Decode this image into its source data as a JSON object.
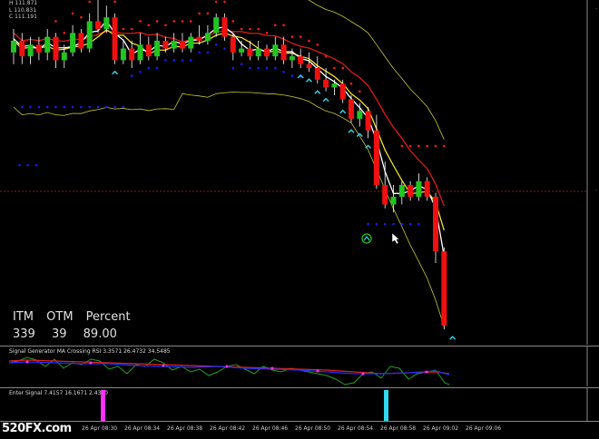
{
  "ohlc": {
    "high": "H 111.871",
    "low": "L 110.831",
    "close": "C 111.191"
  },
  "stats": {
    "headers": [
      "ITM",
      "OTM",
      "Percent"
    ],
    "values": [
      "339",
      "39",
      "89.00"
    ]
  },
  "indicator1": {
    "label": "Signal Generator MA Crossing RSI 3.3571 26.4732 34.5485"
  },
  "indicator2": {
    "label": "Enter Signal 7.4157 16.1671 2.4390"
  },
  "time_axis": [
    "26 Apr 08:30",
    "26 Apr 08:34",
    "26 Apr 08:38",
    "26 Apr 08:42",
    "26 Apr 08:46",
    "26 Apr 08:50",
    "26 Apr 08:54",
    "26 Apr 08:58",
    "26 Apr 09:02",
    "26 Apr 09:06"
  ],
  "watermark": "520FX.com",
  "colors": {
    "bull": "#21c521",
    "bear": "#f01010",
    "signal_up": "#30d8f0",
    "signal_magenta": "#ff30ff",
    "dots_red": "#ff1a1a",
    "dots_blue": "#1a1aff"
  },
  "chart_data": {
    "type": "candlestick",
    "candles": [
      {
        "o": 4,
        "c": 7,
        "h": 10,
        "l": 1
      },
      {
        "o": 7,
        "c": 3,
        "h": 9,
        "l": 1
      },
      {
        "o": 3,
        "c": 6,
        "h": 8,
        "l": 1
      },
      {
        "o": 6,
        "c": 4,
        "h": 8,
        "l": 2
      },
      {
        "o": 4,
        "c": 8,
        "h": 10,
        "l": 2
      },
      {
        "o": 8,
        "c": 2,
        "h": 9,
        "l": 0
      },
      {
        "o": 2,
        "c": 4,
        "h": 6,
        "l": 0
      },
      {
        "o": 4,
        "c": 9,
        "h": 11,
        "l": 3
      },
      {
        "o": 9,
        "c": 5,
        "h": 10,
        "l": 4
      },
      {
        "o": 5,
        "c": 12,
        "h": 14,
        "l": 4
      },
      {
        "o": 12,
        "c": 10,
        "h": 19,
        "l": 9
      },
      {
        "o": 10,
        "c": 13,
        "h": 16,
        "l": 9
      },
      {
        "o": 13,
        "c": 2,
        "h": 14,
        "l": 1
      },
      {
        "o": 2,
        "c": 5,
        "h": 7,
        "l": 1
      },
      {
        "o": 5,
        "c": 2,
        "h": 7,
        "l": 0
      },
      {
        "o": 2,
        "c": 6,
        "h": 9,
        "l": 1
      },
      {
        "o": 6,
        "c": 3,
        "h": 8,
        "l": 2
      },
      {
        "o": 3,
        "c": 7,
        "h": 9,
        "l": 2
      },
      {
        "o": 7,
        "c": 5,
        "h": 8,
        "l": 4
      },
      {
        "o": 5,
        "c": 7,
        "h": 9,
        "l": 4
      },
      {
        "o": 7,
        "c": 5,
        "h": 9,
        "l": 4
      },
      {
        "o": 5,
        "c": 8,
        "h": 9,
        "l": 4
      },
      {
        "o": 8,
        "c": 7,
        "h": 11,
        "l": 6
      },
      {
        "o": 7,
        "c": 9,
        "h": 11,
        "l": 6
      },
      {
        "o": 9,
        "c": 13,
        "h": 14,
        "l": 8
      },
      {
        "o": 13,
        "c": 8,
        "h": 14,
        "l": 7
      },
      {
        "o": 8,
        "c": 4,
        "h": 9,
        "l": 2
      },
      {
        "o": 4,
        "c": 5,
        "h": 7,
        "l": 3
      },
      {
        "o": 5,
        "c": 3,
        "h": 7,
        "l": 2
      },
      {
        "o": 3,
        "c": 5,
        "h": 7,
        "l": 2
      },
      {
        "o": 5,
        "c": 3,
        "h": 6,
        "l": 2
      },
      {
        "o": 3,
        "c": 6,
        "h": 8,
        "l": 2
      },
      {
        "o": 6,
        "c": 2,
        "h": 8,
        "l": 1
      },
      {
        "o": 2,
        "c": 3,
        "h": 5,
        "l": 0
      },
      {
        "o": 3,
        "c": 1,
        "h": 5,
        "l": 0
      },
      {
        "o": 1,
        "c": 0,
        "h": 4,
        "l": -1
      },
      {
        "o": 0,
        "c": -3,
        "h": 3,
        "l": -4
      },
      {
        "o": -3,
        "c": -5,
        "h": 0,
        "l": -6
      },
      {
        "o": -5,
        "c": -4,
        "h": -3,
        "l": -7
      },
      {
        "o": -4,
        "c": -8,
        "h": -3,
        "l": -9
      },
      {
        "o": -8,
        "c": -13,
        "h": -7,
        "l": -14
      },
      {
        "o": -13,
        "c": -11,
        "h": -9,
        "l": -15
      },
      {
        "o": -11,
        "c": -16,
        "h": -10,
        "l": -18
      },
      {
        "o": -16,
        "c": -30,
        "h": -12,
        "l": -31
      },
      {
        "o": -30,
        "c": -35,
        "h": -24,
        "l": -36
      },
      {
        "o": -35,
        "c": -33,
        "h": -30,
        "l": -37
      },
      {
        "o": -33,
        "c": -30,
        "h": -29,
        "l": -35
      },
      {
        "o": -30,
        "c": -33,
        "h": -29,
        "l": -34
      },
      {
        "o": -33,
        "c": -29,
        "h": -27,
        "l": -34
      },
      {
        "o": -29,
        "c": -33,
        "h": -28,
        "l": -34
      },
      {
        "o": -33,
        "c": -47,
        "h": -32,
        "l": -50
      },
      {
        "o": -47,
        "c": -66,
        "h": -46,
        "l": -67
      }
    ]
  }
}
